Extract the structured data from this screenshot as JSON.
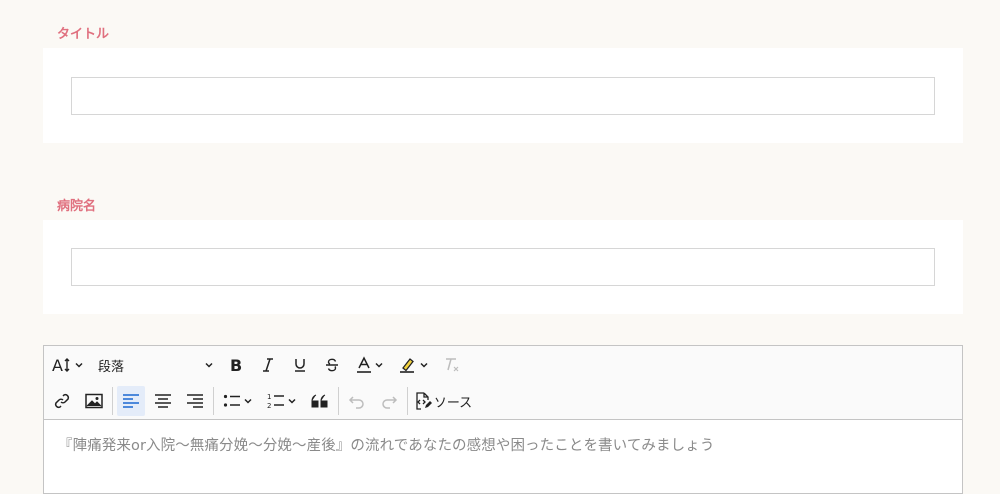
{
  "title_field": {
    "label": "タイトル",
    "value": "",
    "placeholder": ""
  },
  "hospital_field": {
    "label": "病院名",
    "value": "",
    "placeholder": ""
  },
  "editor": {
    "toolbar": {
      "paragraph_select": "段落",
      "source_label": "ソース"
    },
    "placeholder": "『陣痛発来or入院〜無痛分娩〜分娩〜産後』の流れであなたの感想や困ったことを書いてみましょう"
  },
  "colors": {
    "label": "#e0707f",
    "active_button_bg": "#e4ecf9",
    "active_button_icon": "#1a66d1",
    "page_bg": "#fbf9f5"
  },
  "icons": [
    "font-size-icon",
    "bold-icon",
    "italic-icon",
    "underline-icon",
    "strikethrough-icon",
    "font-color-icon",
    "highlight-icon",
    "remove-format-icon",
    "link-icon",
    "image-icon",
    "align-left-icon",
    "align-center-icon",
    "align-right-icon",
    "bulleted-list-icon",
    "numbered-list-icon",
    "blockquote-icon",
    "undo-icon",
    "redo-icon",
    "source-icon",
    "chevron-down-icon"
  ]
}
